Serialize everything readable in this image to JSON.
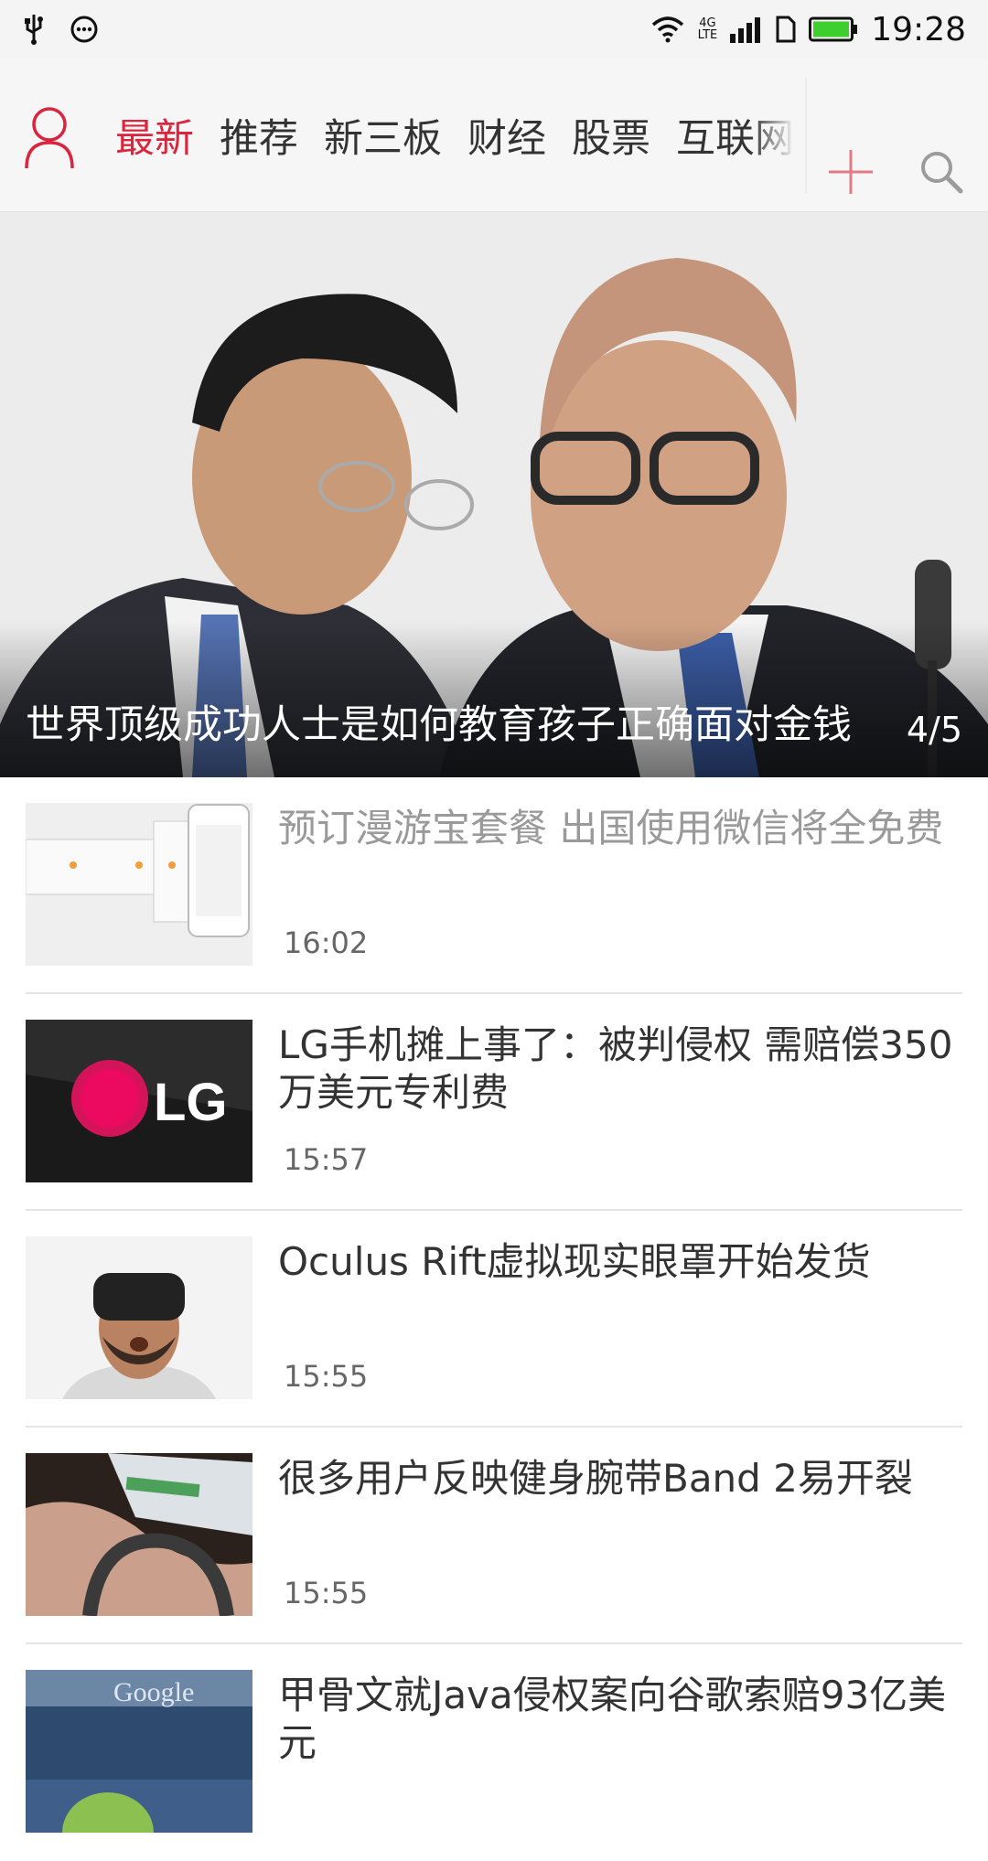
{
  "status_bar": {
    "time": "19:28",
    "network_label_top": "4G",
    "network_label_bottom": "LTE"
  },
  "header": {
    "tabs": [
      {
        "label": "最新",
        "active": true
      },
      {
        "label": "推荐",
        "active": false
      },
      {
        "label": "新三板",
        "active": false
      },
      {
        "label": "财经",
        "active": false
      },
      {
        "label": "股票",
        "active": false
      },
      {
        "label": "互联网",
        "active": false
      }
    ],
    "accent_color": "#d7263d"
  },
  "hero": {
    "caption": "世界顶级成功人士是如何教育孩子正确面对金钱",
    "pager": "4/5"
  },
  "news": [
    {
      "title": "预订漫游宝套餐 出国使用微信将全免费",
      "time": "16:02",
      "read": true
    },
    {
      "title": "LG手机摊上事了：被判侵权 需赔偿350万美元专利费",
      "time": "15:57",
      "read": false
    },
    {
      "title": "Oculus Rift虚拟现实眼罩开始发货",
      "time": "15:55",
      "read": false
    },
    {
      "title": "很多用户反映健身腕带Band 2易开裂",
      "time": "15:55",
      "read": false
    },
    {
      "title": "甲骨文就Java侵权案向谷歌索赔93亿美元",
      "time": "",
      "read": false
    }
  ],
  "thumb_text": {
    "lg_logo": "LG",
    "google_sign": "Google"
  }
}
